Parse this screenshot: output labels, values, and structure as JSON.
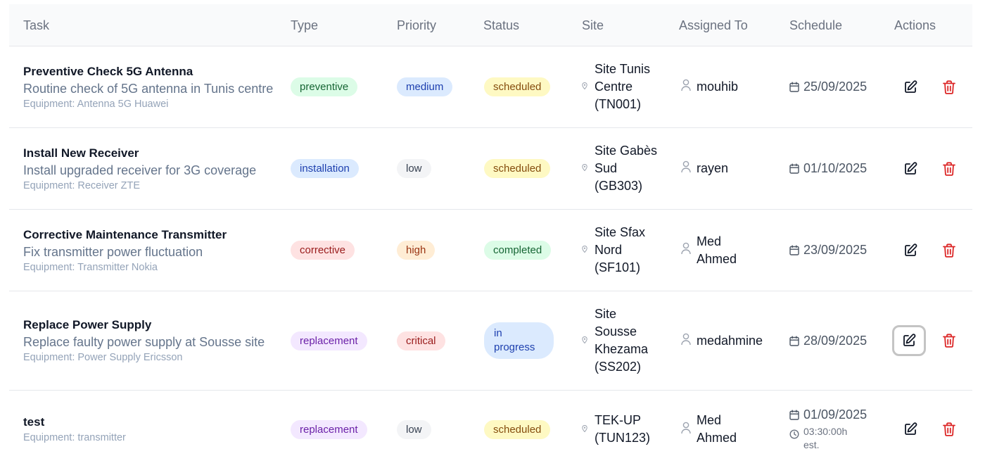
{
  "table": {
    "headers": {
      "task": "Task",
      "type": "Type",
      "priority": "Priority",
      "status": "Status",
      "site": "Site",
      "assigned_to": "Assigned To",
      "schedule": "Schedule",
      "actions": "Actions"
    },
    "rows": [
      {
        "title": "Preventive Check 5G Antenna",
        "description": "Routine check of 5G antenna in Tunis centre",
        "equipment": "Equipment: Antenna 5G Huawei",
        "type": "preventive",
        "priority": "medium",
        "status": "scheduled",
        "site_lines": [
          "Site Tunis",
          "Centre",
          "(TN001)"
        ],
        "assignee_lines": [
          "mouhib"
        ],
        "date": "25/09/2025"
      },
      {
        "title": "Install New Receiver",
        "description": "Install upgraded receiver for 3G coverage",
        "equipment": "Equipment: Receiver ZTE",
        "type": "installation",
        "priority": "low",
        "status": "scheduled",
        "site_lines": [
          "Site Gabès",
          "Sud",
          "(GB303)"
        ],
        "assignee_lines": [
          "rayen"
        ],
        "date": "01/10/2025"
      },
      {
        "title": "Corrective Maintenance Transmitter",
        "description": "Fix transmitter power fluctuation",
        "equipment": "Equipment: Transmitter Nokia",
        "type": "corrective",
        "priority": "high",
        "status": "completed",
        "site_lines": [
          "Site Sfax",
          "Nord",
          "(SF101)"
        ],
        "assignee_lines": [
          "Med",
          "Ahmed"
        ],
        "date": "23/09/2025"
      },
      {
        "title": "Replace Power Supply",
        "description": "Replace faulty power supply at Sousse site",
        "equipment": "Equipment: Power Supply Ericsson",
        "type": "replacement",
        "priority": "critical",
        "status_lines": [
          "in",
          "progress"
        ],
        "site_lines": [
          "Site",
          "Sousse",
          "Khezama",
          "(SS202)"
        ],
        "assignee_lines": [
          "medahmine"
        ],
        "date": "28/09/2025"
      },
      {
        "title": "test",
        "equipment": "Equipment: transmitter",
        "type": "replacement",
        "priority": "low",
        "status": "scheduled",
        "site_lines": [
          "TEK-UP",
          "(TUN123)"
        ],
        "assignee_lines": [
          "Med",
          "Ahmed"
        ],
        "date": "01/09/2025",
        "estimate_lines": [
          "03:30:00h",
          "est."
        ]
      }
    ]
  },
  "icons": {
    "site": "map-pin-icon",
    "assignee": "user-icon",
    "schedule": "calendar-icon",
    "estimate": "clock-icon",
    "edit": "edit-icon",
    "delete": "trash-icon"
  },
  "colors": {
    "delete": "#dc2626",
    "edit": "#111827",
    "header_bg": "#f9fafb"
  }
}
